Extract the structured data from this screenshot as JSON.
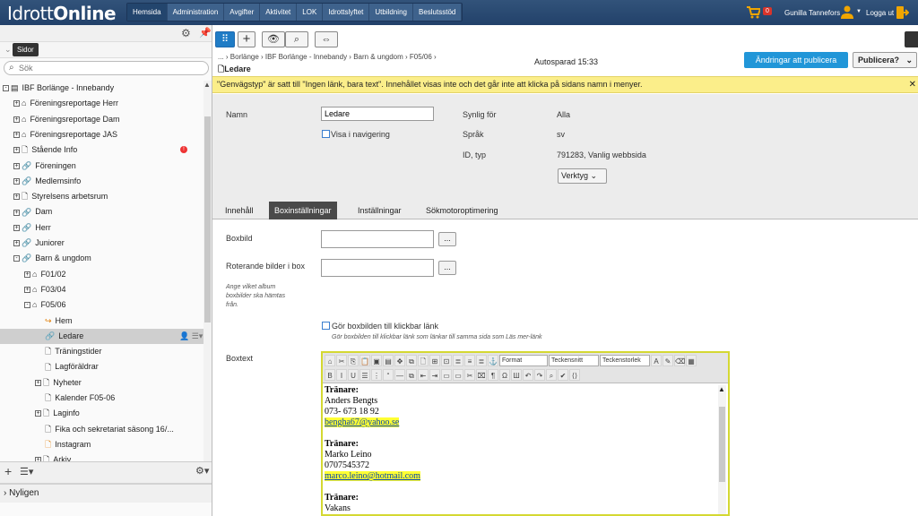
{
  "header": {
    "logo_prefix": "Idrott",
    "logo_suffix": "Online",
    "nav": [
      "Hemsida",
      "Administration",
      "Avgifter",
      "Aktivitet",
      "LOK",
      "Idrottslyftet",
      "Utbildning",
      "Beslutsstöd"
    ],
    "active_nav": 0,
    "cart_count": "0",
    "user_name": "Gunilla Tannefors",
    "logout": "Logga ut"
  },
  "sidebar": {
    "tooltip": "Sidor",
    "search_placeholder": "Sök",
    "recent": "Nyligen",
    "tree": [
      {
        "label": "IBF Borlänge - Innebandy",
        "depth": 0,
        "icon": "site",
        "exp": "-"
      },
      {
        "label": "Föreningsreportage Herr",
        "depth": 1,
        "icon": "home",
        "exp": "+"
      },
      {
        "label": "Föreningsreportage Dam",
        "depth": 1,
        "icon": "home",
        "exp": "+"
      },
      {
        "label": "Föreningsreportage JAS",
        "depth": 1,
        "icon": "home",
        "exp": "+"
      },
      {
        "label": "Stående Info",
        "depth": 1,
        "icon": "page",
        "exp": "+",
        "badge": "!"
      },
      {
        "label": "Föreningen",
        "depth": 1,
        "icon": "link",
        "exp": "+"
      },
      {
        "label": "Medlemsinfo",
        "depth": 1,
        "icon": "link",
        "exp": "+"
      },
      {
        "label": "Styrelsens arbetsrum",
        "depth": 1,
        "icon": "page",
        "exp": "+"
      },
      {
        "label": "Dam",
        "depth": 1,
        "icon": "link",
        "exp": "+"
      },
      {
        "label": "Herr",
        "depth": 1,
        "icon": "link",
        "exp": "+"
      },
      {
        "label": "Juniorer",
        "depth": 1,
        "icon": "link",
        "exp": "+"
      },
      {
        "label": "Barn & ungdom",
        "depth": 1,
        "icon": "link",
        "exp": "-"
      },
      {
        "label": "F01/02",
        "depth": 2,
        "icon": "home",
        "exp": "+"
      },
      {
        "label": "F03/04",
        "depth": 2,
        "icon": "home",
        "exp": "+"
      },
      {
        "label": "F05/06",
        "depth": 2,
        "icon": "home",
        "exp": "-"
      },
      {
        "label": "Hem",
        "depth": 3,
        "icon": "redirect",
        "exp": ""
      },
      {
        "label": "Ledare",
        "depth": 3,
        "icon": "link",
        "exp": "",
        "selected": true
      },
      {
        "label": "Träningstider",
        "depth": 3,
        "icon": "page",
        "exp": ""
      },
      {
        "label": "Lagföräldrar",
        "depth": 3,
        "icon": "page",
        "exp": ""
      },
      {
        "label": "Nyheter",
        "depth": 3,
        "icon": "page",
        "exp": "+"
      },
      {
        "label": "Kalender F05-06",
        "depth": 3,
        "icon": "page",
        "exp": ""
      },
      {
        "label": "Laginfo",
        "depth": 3,
        "icon": "page",
        "exp": "+"
      },
      {
        "label": "Fika och sekretariat säsong 16/...",
        "depth": 3,
        "icon": "page",
        "exp": ""
      },
      {
        "label": "Instagram",
        "depth": 3,
        "icon": "redirect-page",
        "exp": ""
      },
      {
        "label": "Arkiv",
        "depth": 3,
        "icon": "page",
        "exp": "+"
      }
    ]
  },
  "main": {
    "breadcrumb": "... › Borlänge › IBF Borlänge - Innebandy › Barn & ungdom › F05/06 ›",
    "page_title": "Ledare",
    "autosave": "Autosparad 15:33",
    "publish_changes": "Ändringar att publicera",
    "publish_menu": "Publicera?",
    "banner": "\"Genvägstyp\" är satt till \"Ingen länk, bara text\". Innehållet visas inte och det går inte att klicka på sidans namn i menyer.",
    "props": {
      "name_label": "Namn",
      "name_value": "Ledare",
      "show_in_nav": "Visa i navigering",
      "visible_for_label": "Synlig för",
      "visible_for_value": "Alla",
      "language_label": "Språk",
      "language_value": "sv",
      "id_label": "ID, typ",
      "id_value": "791283, Vanlig webbsida",
      "tools": "Verktyg"
    },
    "tabs": [
      "Innehåll",
      "Boxinställningar",
      "Inställningar",
      "Sökmotoroptimering"
    ],
    "active_tab": 1,
    "boxbild_label": "Boxbild",
    "roterande_label": "Roterande bilder i box",
    "roterande_hint": "Ange vilket album boxbilder ska hämtas från.",
    "browse": "...",
    "clickable_label": "Gör boxbilden till klickbar länk",
    "clickable_hint": "Gör boxbilden till klickbar länk som länkar till samma sida som Läs mer-länk",
    "boxtext_label": "Boxtext",
    "editor": {
      "format": "Format",
      "font": "Teckensnitt",
      "size": "Teckenstorlek",
      "lines": [
        {
          "text": "Tränare:",
          "style": "b"
        },
        {
          "text": "Anders Bengts",
          "style": ""
        },
        {
          "text": "073- 673 18 92",
          "style": ""
        },
        {
          "text": "bengha67@yahoo.se",
          "style": "link"
        },
        {
          "text": "",
          "style": ""
        },
        {
          "text": "Tränare:",
          "style": "b"
        },
        {
          "text": "Marko Leino",
          "style": ""
        },
        {
          "text": "0707545372",
          "style": ""
        },
        {
          "text": "marco.leino@hotmail.com",
          "style": "link"
        },
        {
          "text": "",
          "style": ""
        },
        {
          "text": "Tränare:",
          "style": "b"
        },
        {
          "text": "Vakans",
          "style": ""
        }
      ]
    }
  }
}
